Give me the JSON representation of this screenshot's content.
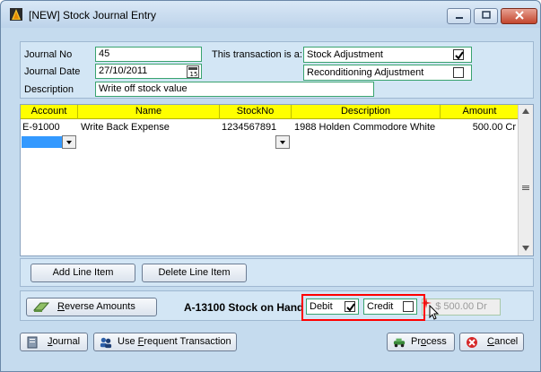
{
  "window": {
    "title": "[NEW] Stock Journal Entry"
  },
  "header": {
    "journal_no_label": "Journal No",
    "journal_no": "45",
    "journal_date_label": "Journal Date",
    "journal_date": "27/10/2011",
    "description_label": "Description",
    "description": "Write off stock value",
    "transaction_is_label": "This transaction is a:",
    "stock_adjustment_label": "Stock Adjustment",
    "stock_adjustment_checked": true,
    "reconditioning_label": "Reconditioning Adjustment",
    "reconditioning_checked": false
  },
  "grid": {
    "columns": [
      "Account",
      "Name",
      "StockNo",
      "Description",
      "Amount"
    ],
    "rows": [
      {
        "account": "E-91000",
        "name": "Write Back Expense",
        "stockno": "1234567891",
        "description": "1988 Holden Commodore  White",
        "amount": "500.00 Cr"
      }
    ]
  },
  "line_buttons": {
    "add": "Add Line Item",
    "delete": "Delete Line Item"
  },
  "bottom": {
    "reverse_prefix": "R",
    "reverse_rest": "everse Amounts",
    "stock_on_hand": "A-13100 Stock on Hand",
    "debit_label": "Debit",
    "debit_checked": true,
    "credit_label": "Credit",
    "credit_checked": false,
    "balance_amount": "$ 500.00 Dr"
  },
  "footer": {
    "journal_prefix": "J",
    "journal_rest": "ournal",
    "frequent_pre": "Use ",
    "frequent_u": "F",
    "frequent_rest": "requent Transaction",
    "process_pre": "Pr",
    "process_u": "o",
    "process_rest": "cess",
    "cancel_u": "C",
    "cancel_rest": "ancel"
  },
  "colors": {
    "grid_header": "#ffff00",
    "field_border": "#39a36f",
    "highlight": "#ff0000"
  }
}
